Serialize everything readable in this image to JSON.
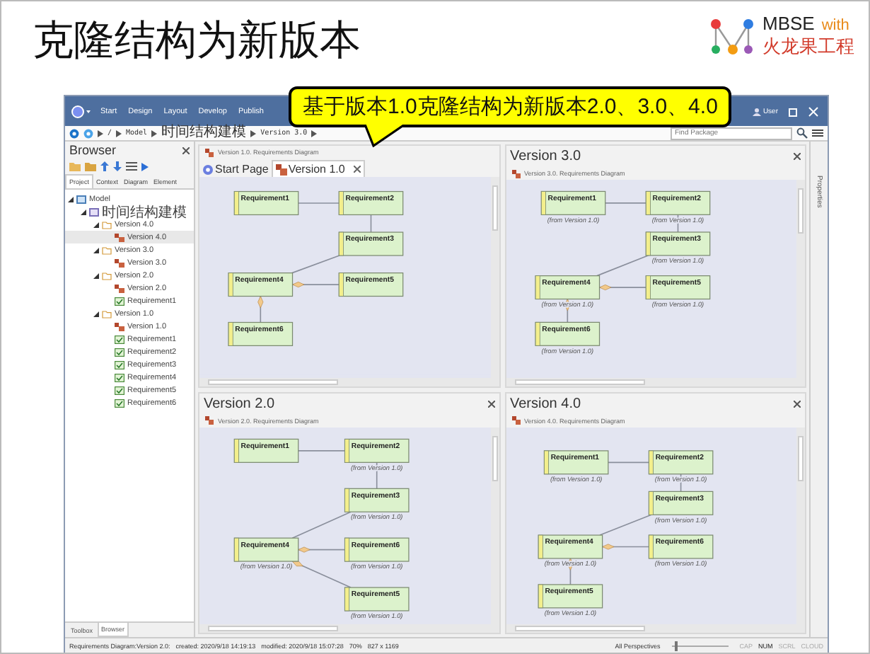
{
  "slide": {
    "title": "克隆结构为新版本",
    "logo": {
      "name": "MBSE",
      "with": "with",
      "company": "火龙果工程"
    }
  },
  "callout": "基于版本1.0克隆结构为新版本2.0、3.0、4.0",
  "app": {
    "menu": [
      "Start",
      "Design",
      "Layout",
      "Develop",
      "Publish"
    ],
    "user": "User",
    "breadcrumb": [
      "/",
      "Model",
      "时间结构建模",
      "Version 3.0"
    ],
    "find": {
      "placeholder": "Find Package"
    },
    "browser": {
      "title": "Browser",
      "tabs": [
        {
          "label": "Project",
          "selected": true
        },
        {
          "label": "Context",
          "selected": false
        },
        {
          "label": "Diagram",
          "selected": false
        },
        {
          "label": "Element",
          "selected": false
        }
      ],
      "tree": [
        {
          "label": "Model",
          "kind": "model",
          "expanded": true,
          "selected": false,
          "children": [
            {
              "label": "时间结构建模",
              "kind": "package",
              "expanded": true,
              "selected": false,
              "children": [
                {
                  "label": "Version 4.0",
                  "kind": "folder",
                  "expanded": true,
                  "selected": false,
                  "children": [
                    {
                      "label": "Version 4.0",
                      "kind": "diagram",
                      "selected": true
                    }
                  ]
                },
                {
                  "label": "Version 3.0",
                  "kind": "folder",
                  "expanded": true,
                  "selected": false,
                  "children": [
                    {
                      "label": "Version 3.0",
                      "kind": "diagram",
                      "selected": false
                    }
                  ]
                },
                {
                  "label": "Version 2.0",
                  "kind": "folder",
                  "expanded": true,
                  "selected": false,
                  "children": [
                    {
                      "label": "Version 2.0",
                      "kind": "diagram",
                      "selected": false
                    },
                    {
                      "label": "Requirement1",
                      "kind": "requirement",
                      "selected": false
                    }
                  ]
                },
                {
                  "label": "Version 1.0",
                  "kind": "folder",
                  "expanded": true,
                  "selected": false,
                  "children": [
                    {
                      "label": "Version 1.0",
                      "kind": "diagram",
                      "selected": false
                    },
                    {
                      "label": "Requirement1",
                      "kind": "requirement",
                      "selected": false
                    },
                    {
                      "label": "Requirement2",
                      "kind": "requirement",
                      "selected": false
                    },
                    {
                      "label": "Requirement3",
                      "kind": "requirement",
                      "selected": false
                    },
                    {
                      "label": "Requirement4",
                      "kind": "requirement",
                      "selected": false
                    },
                    {
                      "label": "Requirement5",
                      "kind": "requirement",
                      "selected": false
                    },
                    {
                      "label": "Requirement6",
                      "kind": "requirement",
                      "selected": false
                    }
                  ]
                }
              ]
            }
          ]
        }
      ],
      "bottom_tabs": [
        {
          "label": "Toolbox",
          "selected": false
        },
        {
          "label": "Browser",
          "selected": true
        }
      ]
    },
    "panels": [
      {
        "kind": "tabbed",
        "subtitle": "Version 1.0.  Requirements Diagram",
        "tabs": [
          {
            "label": "Start Page",
            "selected": false
          },
          {
            "label": "Version 1.0",
            "selected": true
          }
        ],
        "nodes": [
          {
            "name": "Requirement1"
          },
          {
            "name": "Requirement2"
          },
          {
            "name": "Requirement3"
          },
          {
            "name": "Requirement4"
          },
          {
            "name": "Requirement5"
          },
          {
            "name": "Requirement6"
          }
        ]
      },
      {
        "kind": "plain",
        "title": "Version 3.0",
        "subtitle": "Version 3.0.  Requirements Diagram",
        "nodes": [
          {
            "name": "Requirement1",
            "note": "(from Version 1.0)"
          },
          {
            "name": "Requirement2",
            "note": "(from Version 1.0)"
          },
          {
            "name": "Requirement3",
            "note": "(from Version 1.0)"
          },
          {
            "name": "Requirement4",
            "note": "(from Version 1.0)"
          },
          {
            "name": "Requirement5",
            "note": "(from Version 1.0)"
          },
          {
            "name": "Requirement6",
            "note": "(from Version 1.0)"
          }
        ]
      },
      {
        "kind": "plain",
        "title": "Version 2.0",
        "subtitle": "Version 2.0.  Requirements Diagram",
        "nodes": [
          {
            "name": "Requirement1"
          },
          {
            "name": "Requirement2",
            "note": "(from Version 1.0)"
          },
          {
            "name": "Requirement3",
            "note": "(from Version 1.0)"
          },
          {
            "name": "Requirement4",
            "note": "(from Version 1.0)"
          },
          {
            "name": "Requirement6",
            "note": "(from Version 1.0)"
          },
          {
            "name": "Requirement5",
            "note": "(from Version 1.0)"
          }
        ]
      },
      {
        "kind": "plain",
        "title": "Version 4.0",
        "subtitle": "Version 4.0.  Requirements Diagram",
        "nodes": [
          {
            "name": "Requirement1",
            "note": "(from Version 1.0)"
          },
          {
            "name": "Requirement2",
            "note": "(from Version 1.0)"
          },
          {
            "name": "Requirement3",
            "note": "(from Version 1.0)"
          },
          {
            "name": "Requirement4",
            "note": "(from Version 1.0)"
          },
          {
            "name": "Requirement6",
            "note": "(from Version 1.0)"
          },
          {
            "name": "Requirement5",
            "note": "(from Version 1.0)"
          }
        ]
      }
    ],
    "side_tabs": [
      "Properties"
    ],
    "status": {
      "diagram": "Requirements Diagram:Version 2.0:",
      "created": "created: 2020/9/18 14:19:13",
      "modified": "modified: 2020/9/18 15:07:28",
      "zoom": "70%",
      "size": "827 x 1169",
      "perspective": "All Perspectives",
      "zoom_slider": {
        "level": 0.05
      },
      "indicators": [
        {
          "label": "CAP",
          "on": false
        },
        {
          "label": "NUM",
          "on": true
        },
        {
          "label": "SCRL",
          "on": false
        },
        {
          "label": "CLOUD",
          "on": false
        }
      ]
    }
  }
}
